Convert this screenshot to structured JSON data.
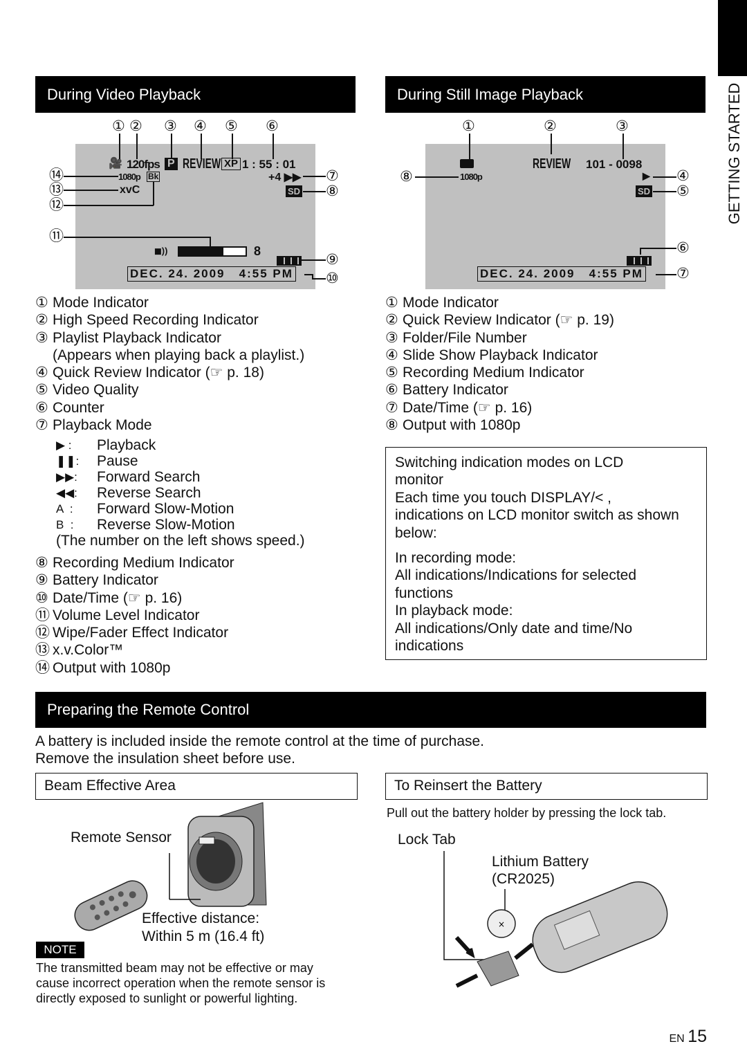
{
  "side_tab": {
    "label": "GETTING STARTED"
  },
  "video": {
    "header": "During Video Playback",
    "screen": {
      "mode": "🎥",
      "fps": "120fps",
      "playlist": "P",
      "review": "REVIEW",
      "quality": "XP",
      "counter": "1 : 55 : 01",
      "output": "1080p",
      "wipe": "Bk",
      "xvc": "xvC",
      "speed": "+4 ▶▶",
      "medium": "SD",
      "volume_icon": "speaker-icon",
      "volume_level": 8,
      "volume_max": 12,
      "datetime": "DEC. 24. 2009   4:55 PM",
      "callouts": [
        "①",
        "②",
        "③",
        "④",
        "⑤",
        "⑥",
        "⑦",
        "⑧",
        "⑨",
        "⑩",
        "⑪",
        "⑫",
        "⑬",
        "⑭"
      ]
    },
    "items_a": [
      {
        "num": "①",
        "text": "Mode Indicator"
      },
      {
        "num": "②",
        "text": "High Speed Recording Indicator"
      },
      {
        "num": "③",
        "text": "Playlist Playback Indicator"
      },
      {
        "num": "",
        "text": "(Appears when playing back a playlist.)"
      },
      {
        "num": "④",
        "text": "Quick Review Indicator (☞ p. 18)"
      },
      {
        "num": "⑤",
        "text": "Video Quality"
      },
      {
        "num": "⑥",
        "text": "Counter"
      },
      {
        "num": "⑦",
        "text": "Playback Mode"
      }
    ],
    "modes": [
      {
        "sym": "▶ :",
        "text": "Playback"
      },
      {
        "sym": "❚❚:",
        "text": "Pause"
      },
      {
        "sym": "▶▶:",
        "text": "Forward Search"
      },
      {
        "sym": "◀◀:",
        "text": "Reverse Search"
      },
      {
        "sym": "A  :",
        "text": "Forward Slow-Motion"
      },
      {
        "sym": "B  :",
        "text": "Reverse Slow-Motion"
      }
    ],
    "modes_note": "(The number on the left shows speed.)",
    "items_b": [
      {
        "num": "⑧",
        "text": "Recording Medium Indicator"
      },
      {
        "num": "⑨",
        "text": "Battery Indicator"
      },
      {
        "num": "⑩",
        "text": "Date/Time (☞ p. 16)"
      },
      {
        "num": "⑪",
        "text": "Volume Level Indicator"
      },
      {
        "num": "⑫",
        "text": "Wipe/Fader Effect Indicator"
      },
      {
        "num": "⑬",
        "text": "x.v.Color™"
      },
      {
        "num": "⑭",
        "text": "Output with 1080p"
      }
    ]
  },
  "still": {
    "header": "During Still Image Playback",
    "screen": {
      "mode": "camera-icon",
      "review": "REVIEW",
      "file": "101 - 0098",
      "play": "▶",
      "medium": "SD",
      "output": "1080p",
      "datetime": "DEC. 24. 2009   4:55 PM",
      "callouts": [
        "①",
        "②",
        "③",
        "④",
        "⑤",
        "⑥",
        "⑦",
        "⑧"
      ]
    },
    "items": [
      {
        "num": "①",
        "text": "Mode Indicator"
      },
      {
        "num": "②",
        "text": "Quick Review Indicator (☞ p. 19)"
      },
      {
        "num": "③",
        "text": "Folder/File Number"
      },
      {
        "num": "④",
        "text": "Slide Show Playback Indicator"
      },
      {
        "num": "⑤",
        "text": "Recording Medium Indicator"
      },
      {
        "num": "⑥",
        "text": "Battery Indicator"
      },
      {
        "num": "⑦",
        "text": "Date/Time (☞ p. 16)"
      },
      {
        "num": "⑧",
        "text": "Output with 1080p"
      }
    ]
  },
  "info_box": {
    "lines": [
      "Switching indication modes on LCD",
      "monitor",
      "Each time you touch DISPLAY/< ,",
      "indications on LCD monitor switch as shown",
      "below:",
      "In recording mode:",
      "All indications/Indications for selected",
      "functions",
      "In playback mode:",
      "All indications/Only date and time/No",
      "indications"
    ]
  },
  "remote": {
    "header": "Preparing the Remote Control",
    "intro": [
      "A battery is included inside the remote control at the time of purchase.",
      "Remove the insulation sheet before use."
    ],
    "beam": {
      "title": "Beam Effective Area",
      "sensor": "Remote Sensor",
      "distance": [
        "Effective distance:",
        "Within 5 m (16.4 ft)"
      ]
    },
    "note": {
      "label": "NOTE",
      "lines": [
        "The transmitted beam may not be effective or may",
        "cause incorrect operation when the remote sensor is",
        "directly exposed to sunlight or powerful lighting."
      ]
    },
    "reinsert": {
      "title": "To Reinsert the Battery",
      "instruction": "Pull out the battery holder by pressing the lock tab.",
      "lock_tab": "Lock Tab",
      "battery": [
        "Lithium Battery",
        "(CR2025)"
      ]
    }
  },
  "footer": {
    "lang": "EN",
    "page": "15"
  }
}
